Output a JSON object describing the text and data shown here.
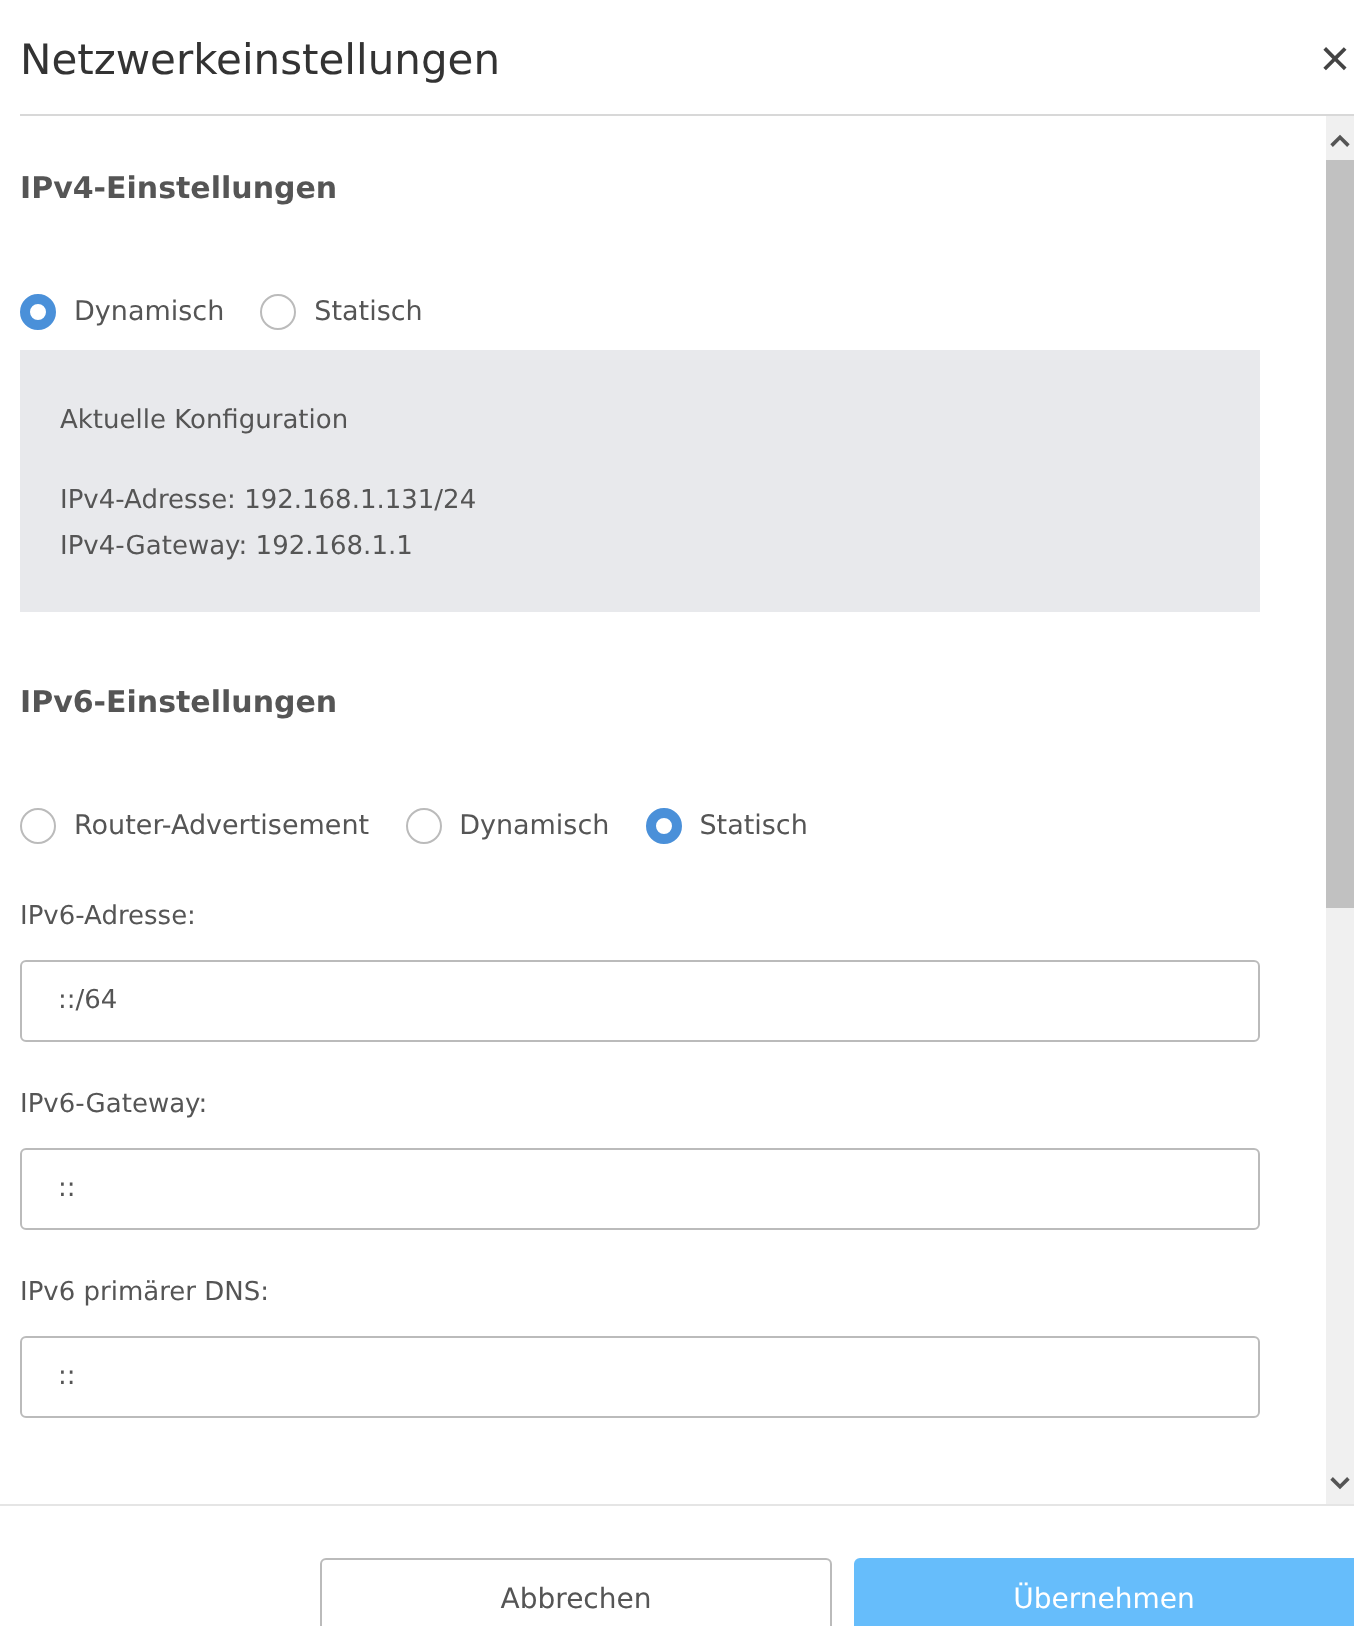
{
  "dialog": {
    "title": "Netzwerkeinstellungen",
    "close": "×"
  },
  "ipv4": {
    "heading": "IPv4-Einstellungen",
    "modes": [
      {
        "label": "Dynamisch",
        "selected": true
      },
      {
        "label": "Statisch",
        "selected": false
      }
    ],
    "info": {
      "title": "Aktuelle Konfiguration",
      "lines": [
        "IPv4-Adresse: 192.168.1.131/24",
        "IPv4-Gateway: 192.168.1.1"
      ]
    }
  },
  "ipv6": {
    "heading": "IPv6-Einstellungen",
    "modes": [
      {
        "label": "Router-Advertisement",
        "selected": false
      },
      {
        "label": "Dynamisch",
        "selected": false
      },
      {
        "label": "Statisch",
        "selected": true
      }
    ],
    "fields": [
      {
        "label": "IPv6-Adresse:",
        "value": "::/64"
      },
      {
        "label": "IPv6-Gateway:",
        "value": "::"
      },
      {
        "label": "IPv6 primärer DNS:",
        "value": "::"
      }
    ]
  },
  "buttons": [
    {
      "label": "Abbrechen",
      "kind": "secondary"
    },
    {
      "label": "Übernehmen",
      "kind": "primary"
    }
  ]
}
